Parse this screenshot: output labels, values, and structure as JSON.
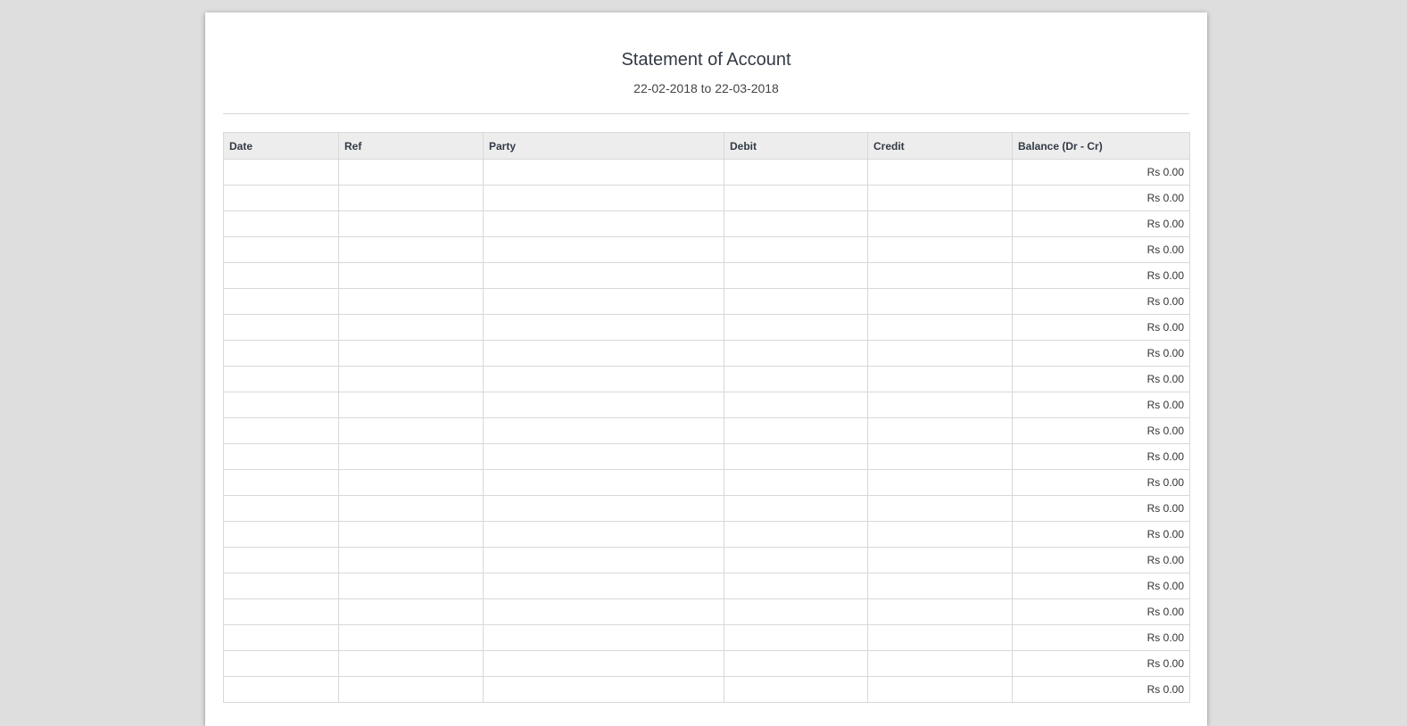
{
  "document": {
    "title": "Statement of Account",
    "period": "22-02-2018 to 22-03-2018"
  },
  "table": {
    "columns": [
      "Date",
      "Ref",
      "Party",
      "Debit",
      "Credit",
      "Balance (Dr - Cr)"
    ],
    "rows": [
      {
        "date": "",
        "ref": "",
        "party": "",
        "debit": "",
        "credit": "",
        "balance": "Rs 0.00"
      },
      {
        "date": "",
        "ref": "",
        "party": "",
        "debit": "",
        "credit": "",
        "balance": "Rs 0.00"
      },
      {
        "date": "",
        "ref": "",
        "party": "",
        "debit": "",
        "credit": "",
        "balance": "Rs 0.00"
      },
      {
        "date": "",
        "ref": "",
        "party": "",
        "debit": "",
        "credit": "",
        "balance": "Rs 0.00"
      },
      {
        "date": "",
        "ref": "",
        "party": "",
        "debit": "",
        "credit": "",
        "balance": "Rs 0.00"
      },
      {
        "date": "",
        "ref": "",
        "party": "",
        "debit": "",
        "credit": "",
        "balance": "Rs 0.00"
      },
      {
        "date": "",
        "ref": "",
        "party": "",
        "debit": "",
        "credit": "",
        "balance": "Rs 0.00"
      },
      {
        "date": "",
        "ref": "",
        "party": "",
        "debit": "",
        "credit": "",
        "balance": "Rs 0.00"
      },
      {
        "date": "",
        "ref": "",
        "party": "",
        "debit": "",
        "credit": "",
        "balance": "Rs 0.00"
      },
      {
        "date": "",
        "ref": "",
        "party": "",
        "debit": "",
        "credit": "",
        "balance": "Rs 0.00"
      },
      {
        "date": "",
        "ref": "",
        "party": "",
        "debit": "",
        "credit": "",
        "balance": "Rs 0.00"
      },
      {
        "date": "",
        "ref": "",
        "party": "",
        "debit": "",
        "credit": "",
        "balance": "Rs 0.00"
      },
      {
        "date": "",
        "ref": "",
        "party": "",
        "debit": "",
        "credit": "",
        "balance": "Rs 0.00"
      },
      {
        "date": "",
        "ref": "",
        "party": "",
        "debit": "",
        "credit": "",
        "balance": "Rs 0.00"
      },
      {
        "date": "",
        "ref": "",
        "party": "",
        "debit": "",
        "credit": "",
        "balance": "Rs 0.00"
      },
      {
        "date": "",
        "ref": "",
        "party": "",
        "debit": "",
        "credit": "",
        "balance": "Rs 0.00"
      },
      {
        "date": "",
        "ref": "",
        "party": "",
        "debit": "",
        "credit": "",
        "balance": "Rs 0.00"
      },
      {
        "date": "",
        "ref": "",
        "party": "",
        "debit": "",
        "credit": "",
        "balance": "Rs 0.00"
      },
      {
        "date": "",
        "ref": "",
        "party": "",
        "debit": "",
        "credit": "",
        "balance": "Rs 0.00"
      },
      {
        "date": "",
        "ref": "",
        "party": "",
        "debit": "",
        "credit": "",
        "balance": "Rs 0.00"
      },
      {
        "date": "",
        "ref": "",
        "party": "",
        "debit": "",
        "credit": "",
        "balance": "Rs 0.00"
      }
    ]
  }
}
